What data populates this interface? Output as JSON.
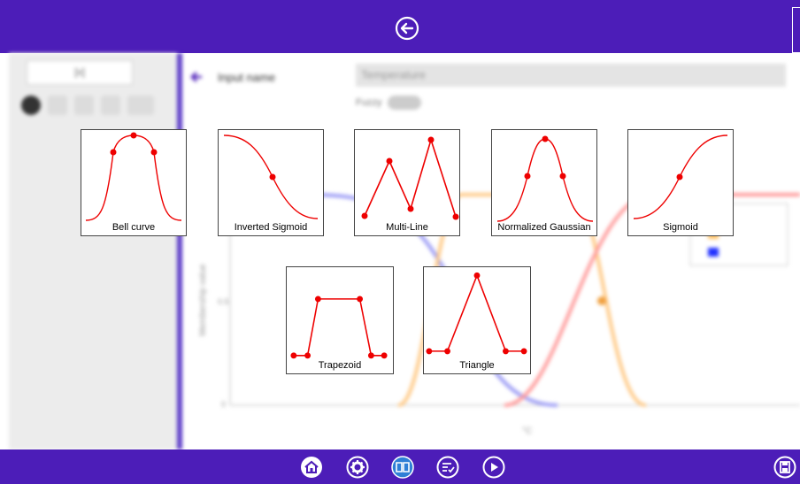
{
  "header": {
    "back_icon": "arrow-left-circle-icon"
  },
  "sidebar": {
    "tab_label": "[x]"
  },
  "form": {
    "input_name_label": "Input name",
    "input_name_value": "Temperature",
    "fuzzy_label": "Fuzzy"
  },
  "chart_bg": {
    "ylabel": "Membership value",
    "xlabel": "°C",
    "ytick_mid": "0.5",
    "ytick_zero": "0"
  },
  "shapes": [
    {
      "label": "Bell curve"
    },
    {
      "label": "Inverted Sigmoid"
    },
    {
      "label": "Multi-Line"
    },
    {
      "label": "Normalized Gaussian"
    },
    {
      "label": "Sigmoid"
    },
    {
      "label": "Trapezoid"
    },
    {
      "label": "Triangle"
    }
  ],
  "footer": {
    "icons": [
      "home-icon",
      "gear-icon",
      "book-icon",
      "checklist-icon",
      "play-icon",
      "save-icon"
    ]
  },
  "colors": {
    "accent": "#4c1db8",
    "curve": "#ee0000"
  }
}
